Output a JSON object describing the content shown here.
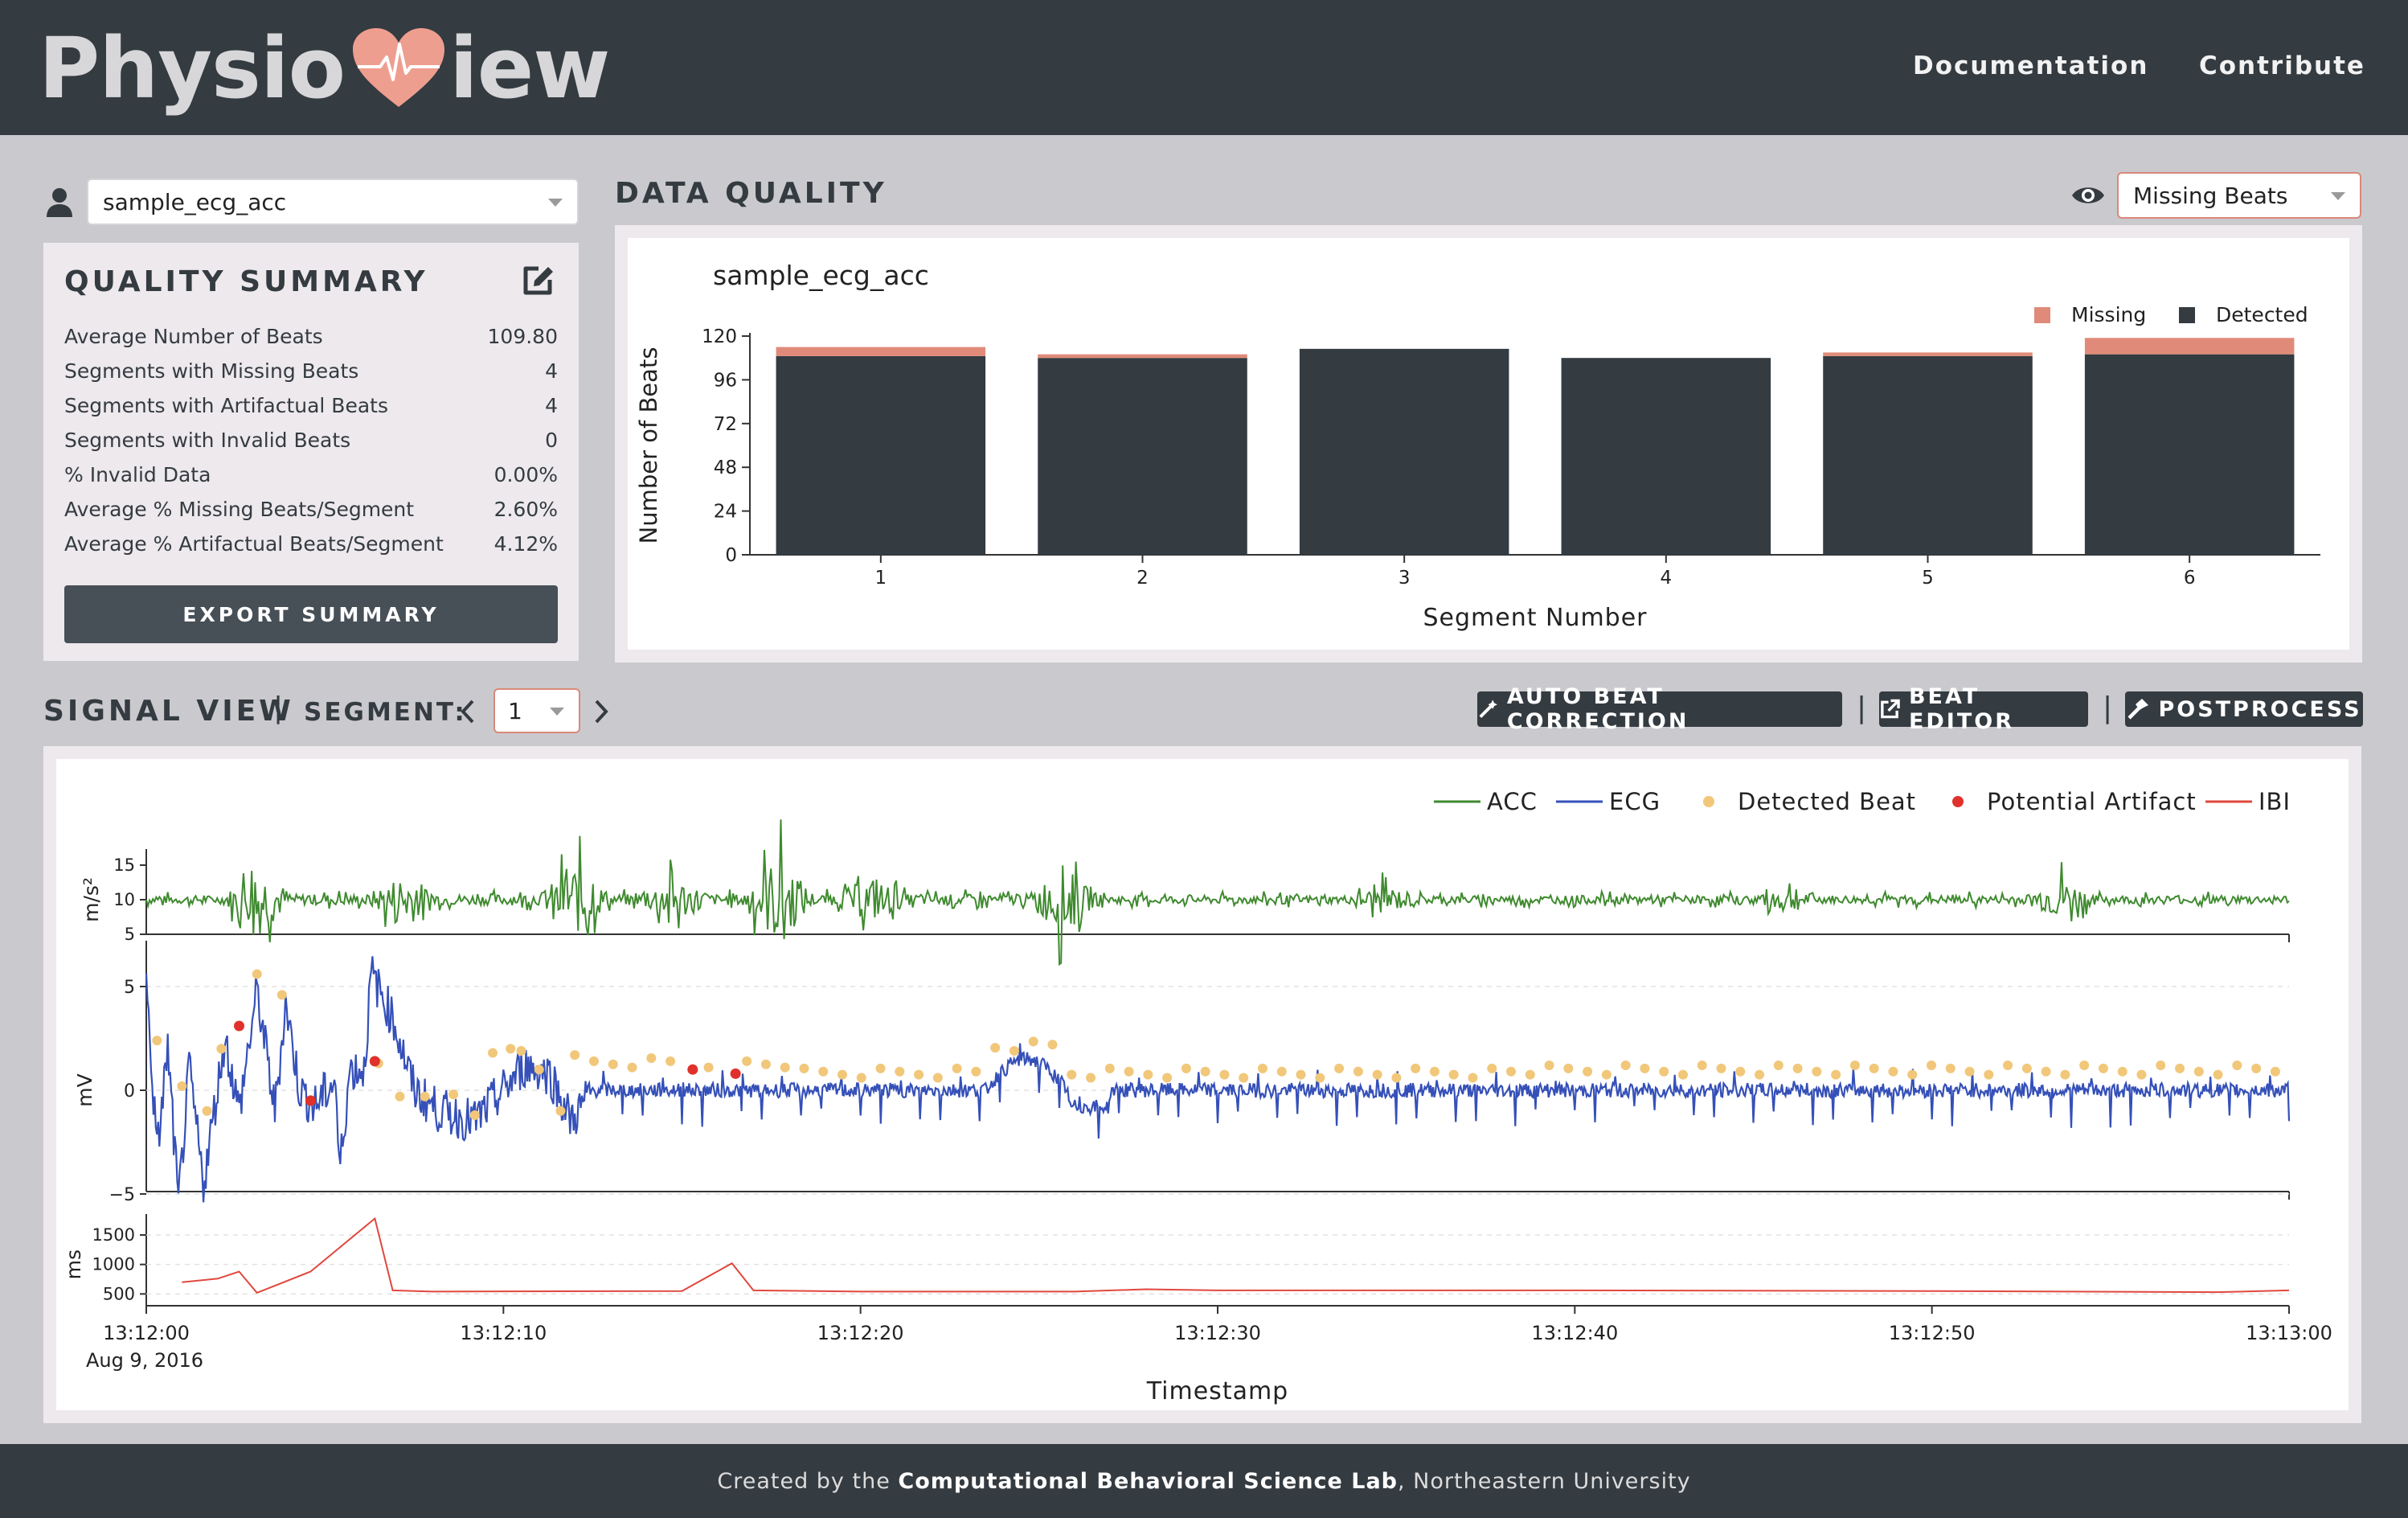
{
  "header": {
    "logo_left": "Physio",
    "logo_right": "iew",
    "nav": [
      "Documentation",
      "Contribute"
    ]
  },
  "subject_select": {
    "value": "sample_ecg_acc"
  },
  "quality_summary": {
    "title": "QUALITY SUMMARY",
    "rows": [
      {
        "label": "Average Number of Beats",
        "value": "109.80"
      },
      {
        "label": "Segments with Missing Beats",
        "value": "4"
      },
      {
        "label": "Segments with Artifactual Beats",
        "value": "4"
      },
      {
        "label": "Segments with Invalid Beats",
        "value": "0"
      },
      {
        "label": "% Invalid Data",
        "value": "0.00%"
      },
      {
        "label": "Average % Missing Beats/Segment",
        "value": "2.60%"
      },
      {
        "label": "Average % Artifactual Beats/Segment",
        "value": "4.12%"
      }
    ],
    "export_label": "EXPORT SUMMARY"
  },
  "data_quality": {
    "title": "DATA QUALITY",
    "view_select": "Missing Beats"
  },
  "signal_view": {
    "title": "SIGNAL VIEW",
    "divider": "|",
    "segment_label": "SEGMENT:",
    "segment_value": "1",
    "buttons": [
      "AUTO BEAT CORRECTION",
      "BEAT EDITOR",
      "POSTPROCESS"
    ]
  },
  "footer": {
    "prefix": "Created by the ",
    "lab": "Computational Behavioral Science Lab",
    "suffix": ", Northeastern University"
  },
  "colors": {
    "header": "#343b41",
    "detected": "#343b41",
    "missing": "#e08b79",
    "acc": "#3f8a2f",
    "ecg": "#3550b8",
    "beat": "#f1c77a",
    "artifact": "#e0322b",
    "ibi": "#e0483e"
  },
  "chart_data": [
    {
      "type": "bar",
      "title": "sample_ecg_acc",
      "xlabel": "Segment Number",
      "ylabel": "Number of Beats",
      "categories": [
        "1",
        "2",
        "3",
        "4",
        "5",
        "6"
      ],
      "ylim": [
        0,
        120
      ],
      "yticks": [
        0,
        24,
        48,
        72,
        96,
        120
      ],
      "stacked": true,
      "legend_position": "top-right",
      "series": [
        {
          "name": "Missing",
          "values": [
            5,
            2,
            0,
            0,
            2,
            9
          ]
        },
        {
          "name": "Detected",
          "values": [
            109,
            108,
            113,
            108,
            109,
            110
          ]
        }
      ]
    },
    {
      "type": "line",
      "xlabel": "Timestamp",
      "x_range": [
        "13:12:00",
        "13:13:00"
      ],
      "xticks": [
        "13:12:00",
        "13:12:10",
        "13:12:20",
        "13:12:30",
        "13:12:40",
        "13:12:50",
        "13:13:00"
      ],
      "date_label": "Aug 9, 2016",
      "legend": [
        "ACC",
        "ECG",
        "Detected Beat",
        "Potential Artifact",
        "IBI"
      ],
      "legend_position": "top-right",
      "panels": [
        {
          "name": "ACC",
          "ylabel": "m/s²",
          "yticks": [
            5,
            10,
            15
          ],
          "baseline": 10
        },
        {
          "name": "ECG",
          "ylabel": "mV",
          "yticks": [
            -5,
            0,
            5
          ],
          "ylim": [
            -5.5,
            6
          ]
        },
        {
          "name": "IBI",
          "ylabel": "ms",
          "yticks": [
            500,
            1000,
            1500
          ]
        }
      ],
      "ibi_points_sec": [
        [
          1,
          700
        ],
        [
          2,
          760
        ],
        [
          2.6,
          880
        ],
        [
          3.1,
          520
        ],
        [
          4.6,
          880
        ],
        [
          6.4,
          1780
        ],
        [
          6.9,
          560
        ],
        [
          8,
          540
        ],
        [
          15,
          550
        ],
        [
          16.4,
          1020
        ],
        [
          17,
          560
        ],
        [
          20,
          540
        ],
        [
          26,
          540
        ],
        [
          28,
          580
        ],
        [
          30,
          560
        ],
        [
          40,
          560
        ],
        [
          50,
          550
        ],
        [
          58,
          530
        ],
        [
          60,
          560
        ]
      ],
      "artifact_beats_sec": [
        [
          2.6,
          3.1
        ],
        [
          4.6,
          -0.5
        ],
        [
          6.4,
          1.4
        ],
        [
          15.3,
          1.0
        ],
        [
          16.5,
          0.8
        ]
      ]
    }
  ]
}
